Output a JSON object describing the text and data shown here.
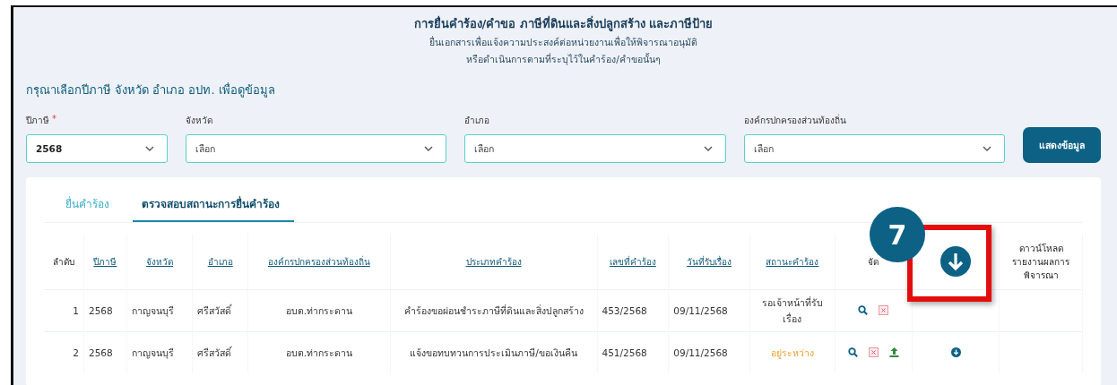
{
  "header": {
    "title": "การยื่นคำร้อง/คำขอ ภาษีที่ดินและสิ่งปลูกสร้าง และภาษีป้าย",
    "subtitle_lines": [
      "ยื่นเอกสารเพื่อแจ้งความประสงค์ต่อหน่วยงานเพื่อให้พิจารณาอนุมัติ",
      "หรือดำเนินการตามที่ระบุไว้ในคำร้อง/คำขอนั้นๆ"
    ]
  },
  "filter": {
    "title": "กรุณาเลือกปีภาษี จังหวัด อำเภอ อปท. เพื่อดูข้อมูล",
    "fields": [
      {
        "label": "ปีภาษี",
        "required_mark": "*",
        "value": "2568"
      },
      {
        "label": "จังหวัด",
        "placeholder": "เลือก"
      },
      {
        "label": "อำเภอ",
        "placeholder": "เลือก"
      },
      {
        "label": "องค์กรปกครองส่วนท้องถิ่น",
        "placeholder": "เลือก"
      }
    ],
    "button": "แสดงข้อมูล"
  },
  "tabs": [
    {
      "label": "ยื่นคำร้อง",
      "selected": false
    },
    {
      "label": "ตรวจสอบสถานะการยื่นคำร้อง",
      "selected": true
    }
  ],
  "table": {
    "columns": [
      {
        "label": "ลำดับ",
        "sortable": false
      },
      {
        "label": "ปีภาษี",
        "sortable": true
      },
      {
        "label": "จังหวัด",
        "sortable": true
      },
      {
        "label": "อำเภอ",
        "sortable": true
      },
      {
        "label": "องค์กรปกครองส่วนท้องถิ่น",
        "sortable": true
      },
      {
        "label": "ประเภทคำร้อง",
        "sortable": true
      },
      {
        "label": "เลขที่คำร้อง",
        "sortable": true
      },
      {
        "label": "วันที่รับเรื่อง",
        "sortable": true
      },
      {
        "label": "สถานะคำร้อง",
        "sortable": true
      },
      {
        "label": "จัด",
        "sortable": false
      },
      {
        "kind": "download"
      },
      {
        "label": "ดาวน์โหลด รายงานผลการพิจารณา",
        "sortable": false
      }
    ],
    "rows": [
      {
        "index": "1",
        "year": "2568",
        "province": "กาญจนบุรี",
        "district": "ศรีสวัสดิ์",
        "org": "อบต.ท่ากระดาน",
        "type": "คำร้องขอผ่อนชำระภาษีที่ดินและสิ่งปลูกสร้าง",
        "number": "453/2568",
        "date": "09/11/2568",
        "status": {
          "text": "รอเจ้าหน้าที่รับเรื่อง",
          "kind": "waiting"
        },
        "actions": [
          {
            "kind": "search"
          },
          {
            "kind": "cancel"
          }
        ],
        "download": false
      },
      {
        "index": "2",
        "year": "2568",
        "province": "กาญจนบุรี",
        "district": "ศรีสวัสดิ์",
        "org": "อบต.ท่ากระดาน",
        "type": "แจ้งขอทบทวนการประเมินภาษี/ขอเงินคืน",
        "number": "451/2568",
        "date": "09/11/2568",
        "status": {
          "text": "อยู่ระหว่าง",
          "kind": "pending"
        },
        "actions": [
          {
            "kind": "search"
          },
          {
            "kind": "cancel"
          },
          {
            "kind": "upload"
          }
        ],
        "download": true
      }
    ]
  },
  "highlight": {
    "step": "7"
  }
}
